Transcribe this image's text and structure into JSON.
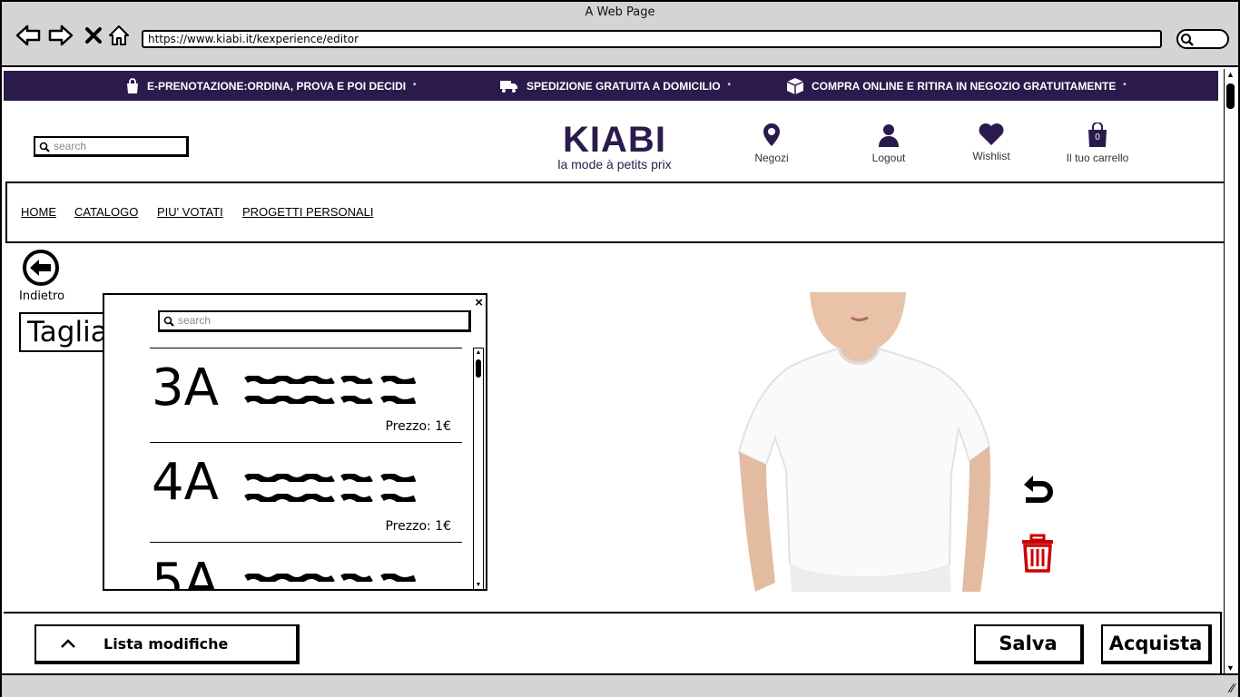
{
  "browser": {
    "title": "A Web Page",
    "url": "https://www.kiabi.it/kexperience/editor"
  },
  "promo": {
    "items": [
      {
        "icon": "shopping-bag-icon",
        "text": "E-PRENOTAZIONE:ORDINA, PROVA E POI DECIDI",
        "mark": "*"
      },
      {
        "icon": "truck-icon",
        "text": "SPEDIZIONE GRATUITA A DOMICILIO",
        "mark": "*"
      },
      {
        "icon": "box-icon",
        "text": "COMPRA ONLINE E RITIRA IN NEGOZIO GRATUITAMENTE",
        "mark": "*"
      }
    ],
    "color": "#2b1b4c"
  },
  "header": {
    "search_placeholder": "search",
    "logo_main": "KIABI",
    "logo_sub": "la mode à petits prix",
    "links": {
      "stores": "Negozi",
      "logout": "Logout",
      "wishlist": "Wishlist",
      "cart": "Il tuo carrello",
      "cart_count": "0"
    }
  },
  "nav": {
    "items": [
      "HOME",
      "CATALOGO",
      "PIU' VOTATI",
      "PROGETTI PERSONALI"
    ]
  },
  "editor": {
    "back_label": "Indietro",
    "section_label": "Taglia",
    "panel": {
      "search_placeholder": "search",
      "close": "×",
      "sizes": [
        {
          "code": "3A",
          "price": "Prezzo: 1€"
        },
        {
          "code": "4A",
          "price": "Prezzo: 1€"
        },
        {
          "code": "5A",
          "price": ""
        }
      ]
    }
  },
  "bottom": {
    "list_label": "Lista modifiche",
    "save_label": "Salva",
    "buy_label": "Acquista"
  },
  "colors": {
    "brand": "#2b1b4c",
    "delete": "#cc0000"
  }
}
